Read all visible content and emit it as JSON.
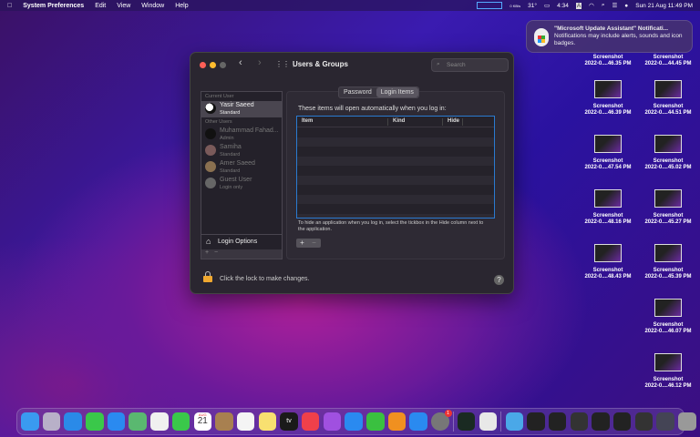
{
  "menubar": {
    "app": "System Preferences",
    "items": [
      "Edit",
      "View",
      "Window",
      "Help"
    ],
    "temp": "31°",
    "battery_time": "4:34",
    "input": "A",
    "datetime": "Sun 21 Aug  11:49 PM",
    "net": "0 KB/s"
  },
  "notification": {
    "title": "\"Microsoft Update Assistant\" Notificati...",
    "body": "Notifications may include alerts, sounds and icon badges."
  },
  "desktop": [
    {
      "name": "Screenshot",
      "sub": "2022-0....46.35 PM"
    },
    {
      "name": "Screenshot",
      "sub": "2022-0....44.45 PM"
    },
    {
      "name": "Screenshot",
      "sub": "2022-0....46.39 PM"
    },
    {
      "name": "Screenshot",
      "sub": "2022-0....44.51 PM"
    },
    {
      "name": "Screenshot",
      "sub": "2022-0....47.54 PM"
    },
    {
      "name": "Screenshot",
      "sub": "2022-0....45.02 PM"
    },
    {
      "name": "Screenshot",
      "sub": "2022-0....48.16 PM"
    },
    {
      "name": "Screenshot",
      "sub": "2022-0....45.27 PM"
    },
    {
      "name": "Screenshot",
      "sub": "2022-0....48.43 PM"
    },
    {
      "name": "Screenshot",
      "sub": "2022-0....45.39 PM"
    },
    {
      "name": "Screenshot",
      "sub": "2022-0....46.07 PM"
    },
    {
      "name": "Screenshot",
      "sub": "2022-0....46.12 PM"
    }
  ],
  "window": {
    "title": "Users & Groups",
    "search_placeholder": "Search",
    "sidebar": {
      "current_label": "Current User",
      "other_label": "Other Users",
      "users": [
        {
          "name": "Yasir Saeed",
          "role": "Standard"
        },
        {
          "name": "Muhammad Fahad...",
          "role": "Admin"
        },
        {
          "name": "Samiha",
          "role": "Standard"
        },
        {
          "name": "Amer Saeed",
          "role": "Standard"
        },
        {
          "name": "Guest User",
          "role": "Login only"
        }
      ],
      "login_options": "Login Options",
      "add": "+",
      "remove": "−"
    },
    "tabs": [
      "Password",
      "Login Items"
    ],
    "intro": "These items will open automatically when you log in:",
    "columns": [
      "Item",
      "Kind",
      "Hide"
    ],
    "hint": "To hide an application when you log in, select the tickbox in the Hide column next to the application.",
    "add": "+",
    "remove": "−",
    "lock_text": "Click the lock to make changes.",
    "help": "?"
  },
  "dock": {
    "calendar_day": "21",
    "calendar_month": "AUG",
    "sysprefs_badge": "1",
    "tv": "tv",
    "apps": [
      [
        "finder",
        "#3a9af0"
      ],
      [
        "launchpad",
        "#b8b0c8"
      ],
      [
        "safari",
        "#2a8ae8"
      ],
      [
        "messages",
        "#3ac84a"
      ],
      [
        "mail",
        "#2a8af0"
      ],
      [
        "maps",
        "#5ab870"
      ],
      [
        "photos",
        "#f0f0f0"
      ],
      [
        "facetime",
        "#3ac84a"
      ],
      [
        "calendar",
        "#ffffff"
      ],
      [
        "contacts",
        "#a88050"
      ],
      [
        "reminders",
        "#f4f4f4"
      ],
      [
        "notes",
        "#f8e070"
      ],
      [
        "tv",
        "#1a1a1a"
      ],
      [
        "music",
        "#f0404a"
      ],
      [
        "podcasts",
        "#a050e0"
      ],
      [
        "keynote",
        "#2a8af0"
      ],
      [
        "numbers",
        "#3ac040"
      ],
      [
        "pages",
        "#f09020"
      ],
      [
        "app-store",
        "#2a8af0"
      ],
      [
        "system-preferences",
        "#777777"
      ]
    ],
    "extra": [
      [
        "activity-monitor",
        "#1a2a22"
      ],
      [
        "preview",
        "#e8e8e8"
      ]
    ],
    "right": [
      [
        "downloads-folder",
        "#4aa8e8"
      ],
      [
        "recent-1",
        "#222"
      ],
      [
        "recent-2",
        "#222"
      ],
      [
        "recent-3",
        "#333"
      ],
      [
        "recent-4",
        "#222"
      ],
      [
        "recent-5",
        "#222"
      ],
      [
        "recent-6",
        "#333"
      ],
      [
        "recent-7",
        "#445"
      ],
      [
        "trash",
        "#999"
      ]
    ]
  }
}
